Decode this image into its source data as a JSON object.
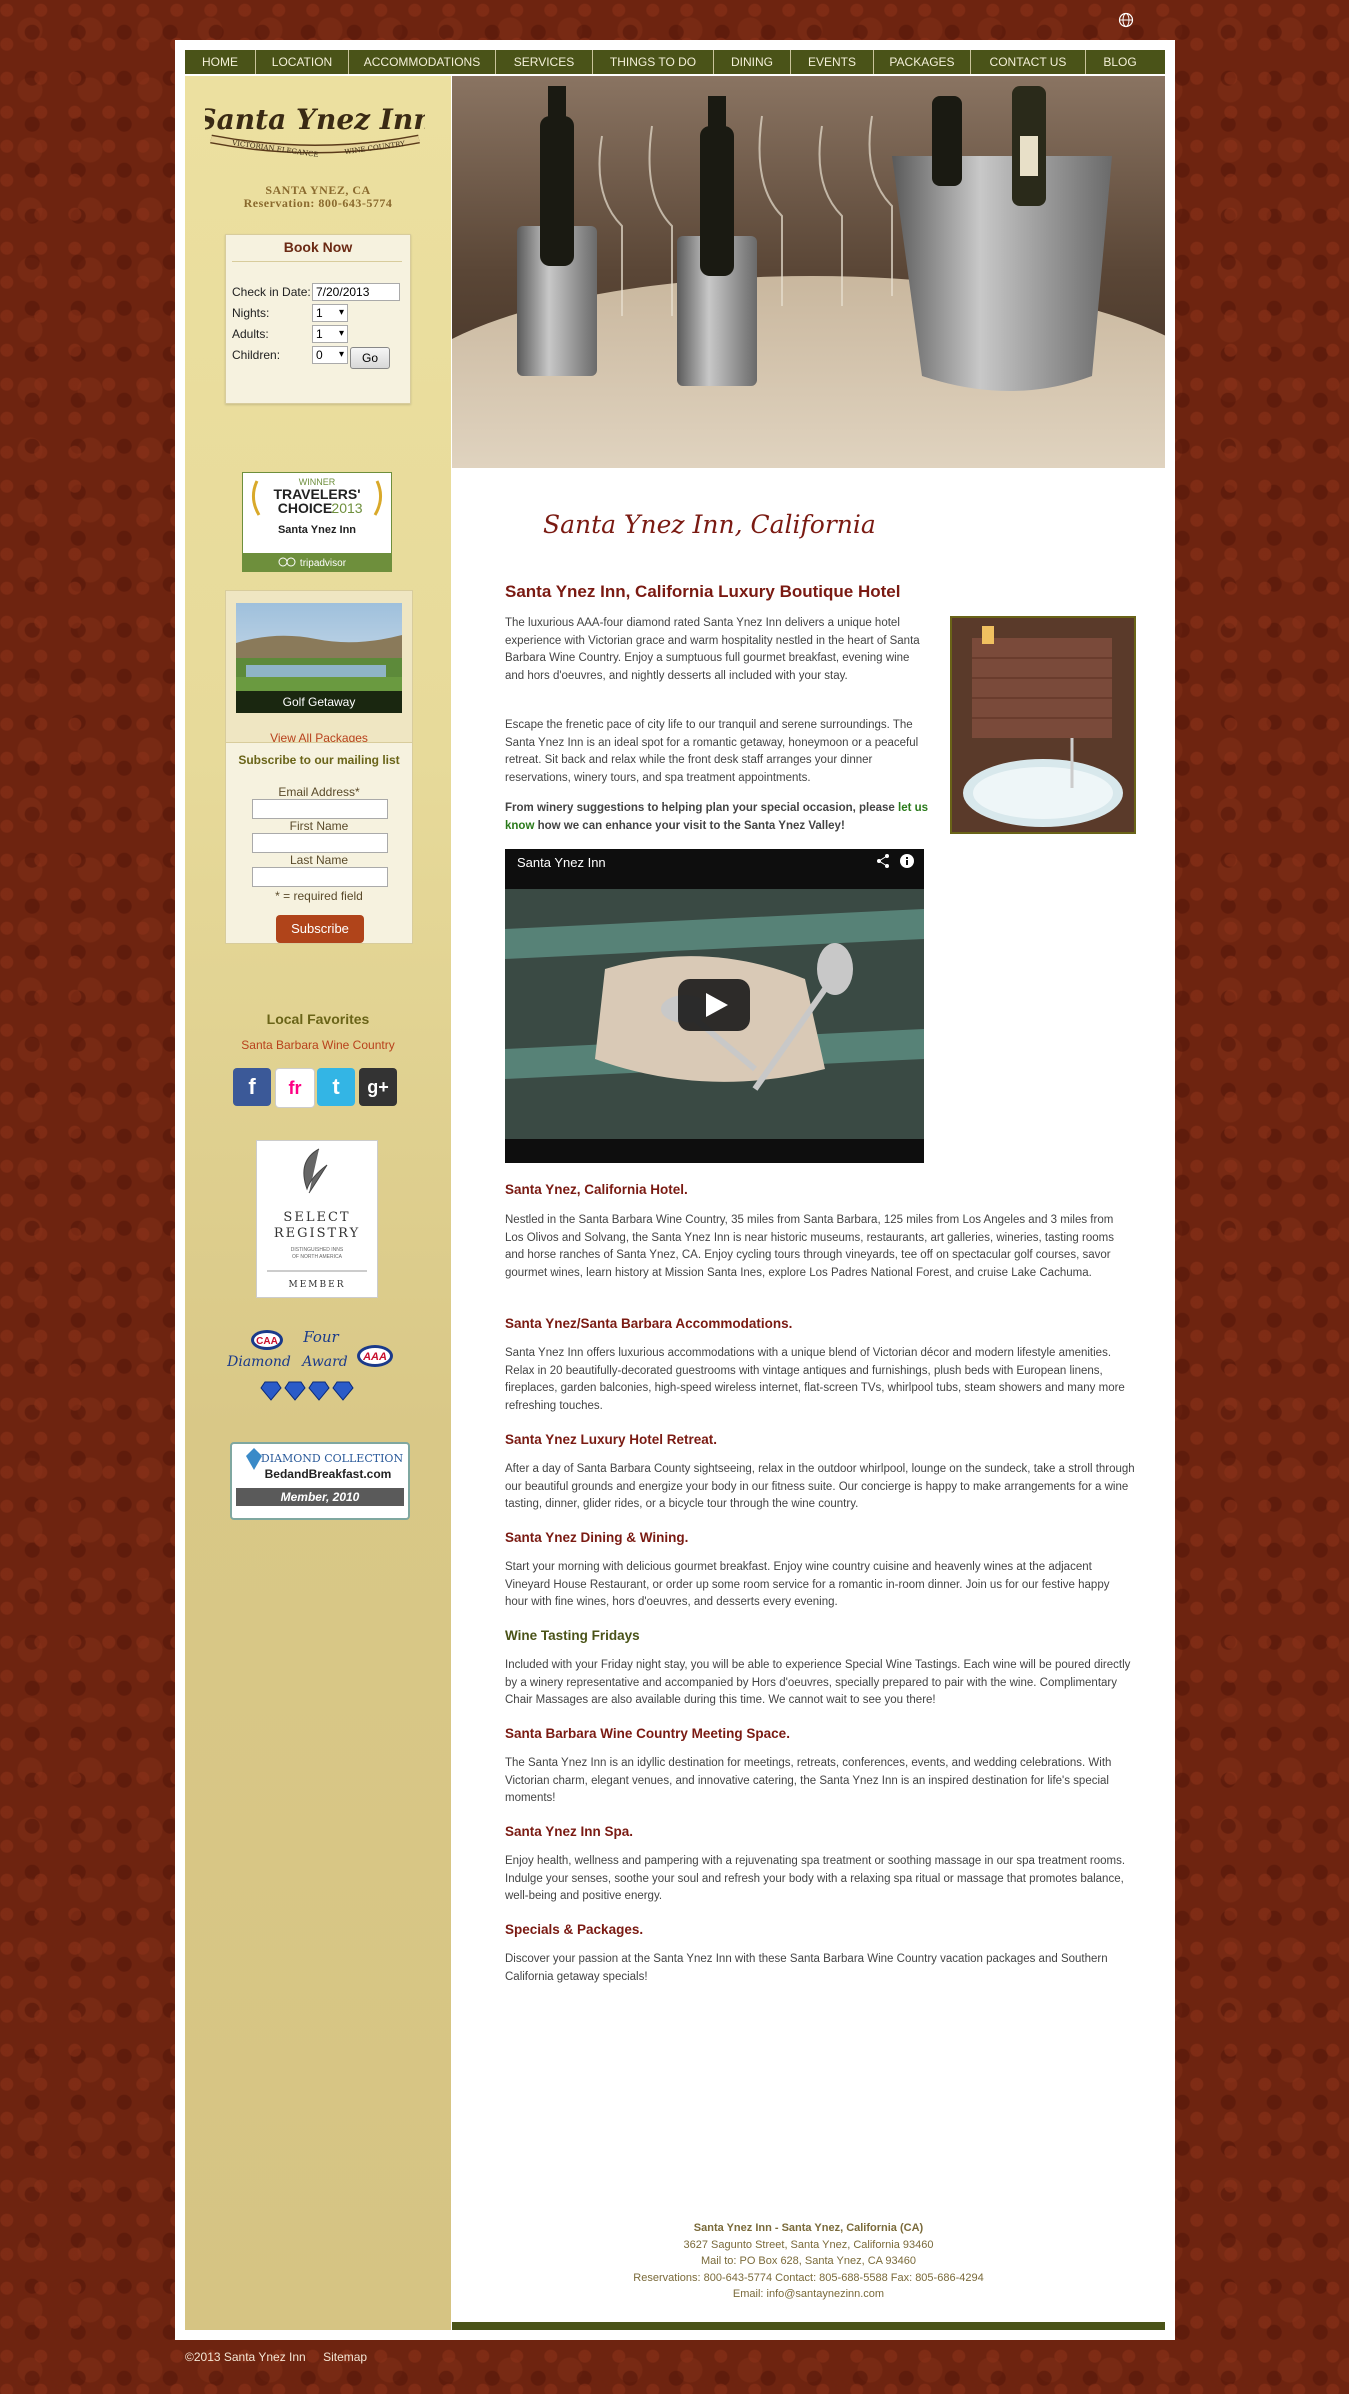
{
  "nav": [
    "HOME",
    "LOCATION",
    "ACCOMMODATIONS",
    "SERVICES",
    "THINGS TO DO",
    "DINING",
    "EVENTS",
    "PACKAGES",
    "CONTACT US",
    "BLOG"
  ],
  "sidebar": {
    "logo": {
      "line1": "Santa Ynez Inn",
      "line2": "VICTORIAN ELEGANCE",
      "line3": "WINE COUNTRY"
    },
    "location": "SANTA YNEZ, CA",
    "reservation": "Reservation: 800-643-5774",
    "booking": {
      "title": "Book Now",
      "checkin_label": "Check in Date:",
      "checkin_value": "7/20/2013",
      "nights_label": "Nights:",
      "nights_value": "1",
      "adults_label": "Adults:",
      "adults_value": "1",
      "children_label": "Children:",
      "children_value": "0",
      "go_label": "Go"
    },
    "tripadvisor": {
      "winner": "WINNER",
      "title": "TRAVELERS'",
      "title2": "CHOICE",
      "year": "2013",
      "name": "Santa Ynez Inn",
      "brand": "tripadvisor"
    },
    "package": {
      "caption": "Golf Getaway",
      "view_all": "View All Packages"
    },
    "mailing": {
      "title": "Subscribe to our mailing list",
      "email_label": "Email Address*",
      "first_label": "First Name",
      "last_label": "Last Name",
      "required_note": "* = required field",
      "subscribe_label": "Subscribe"
    },
    "favorites": {
      "title": "Local Favorites",
      "link": "Santa Barbara Wine Country"
    },
    "social": [
      "f",
      "fr",
      "t",
      "g+"
    ],
    "select_registry": {
      "l1": "SELECT",
      "l2": "REGISTRY",
      "l3": "DISTINGUISHED INNS",
      "l4": "OF NORTH AMERICA",
      "l5": "MEMBER"
    },
    "aaa": {
      "l1": "Four",
      "l2": "Diamond",
      "l3": "Award",
      "caa": "CAA",
      "aaa": "AAA"
    },
    "diamond_collection": {
      "l1": "DIAMOND COLLECTION",
      "l2": "BedandBreakfast.com",
      "l3": "Member, 2010"
    }
  },
  "main": {
    "script_title": "Santa Ynez Inn, California",
    "heading": "Santa Ynez Inn, California Luxury Boutique Hotel",
    "intro1": "The luxurious AAA-four diamond rated Santa Ynez Inn delivers a unique hotel experience with Victorian grace and warm hospitality nestled in the heart of Santa Barbara Wine Country.  Enjoy a sumptuous full gourmet breakfast, evening wine and hors d'oeuvres, and nightly desserts all included with your stay.",
    "intro2": "Escape the frenetic pace of city life to our tranquil and serene surroundings.  The Santa Ynez Inn is an ideal spot for a romantic getaway, honeymoon or a peaceful retreat.  Sit back and relax while the front desk staff arranges your dinner reservations, winery tours, and spa treatment appointments.",
    "intro3_a": "From winery suggestions to helping plan your special occasion, please ",
    "intro3_link": "let us know",
    "intro3_b": " how we can enhance your visit to the Santa Ynez Valley!",
    "video_title": "Santa Ynez Inn",
    "sections": [
      {
        "title": "Santa Ynez, California Hotel.",
        "body": "Nestled in the Santa Barbara Wine Country, 35 miles from Santa Barbara, 125 miles from Los Angeles and 3 miles from Los Olivos and Solvang, the Santa Ynez Inn is near historic museums, restaurants, art galleries, wineries, tasting rooms and horse ranches of Santa Ynez, CA. Enjoy cycling tours through vineyards, tee off on spectacular golf courses, savor gourmet wines, learn history at Mission Santa Ines, explore Los Padres National Forest, and cruise Lake Cachuma."
      },
      {
        "title": "Santa Ynez/Santa Barbara Accommodations.",
        "body": "Santa Ynez Inn offers luxurious accommodations with a unique blend of Victorian décor and modern lifestyle amenities. Relax in 20 beautifully-decorated guestrooms with vintage antiques and furnishings, plush beds with European linens, fireplaces, garden balconies, high-speed wireless internet, flat-screen TVs, whirlpool tubs, steam showers and many more refreshing touches."
      },
      {
        "title": "Santa Ynez Luxury Hotel Retreat.",
        "body": "After a day of Santa Barbara County sightseeing, relax in the outdoor whirlpool, lounge on the sundeck, take a stroll through our beautiful grounds and energize your body in our fitness suite. Our concierge is happy to make arrangements for a wine tasting, dinner, glider rides, or a bicycle tour through the wine country."
      },
      {
        "title": "Santa Ynez Dining & Wining.",
        "body": "Start your morning with delicious gourmet breakfast. Enjoy wine country cuisine and heavenly wines at the adjacent Vineyard House Restaurant, or order up some room service for a romantic in-room dinner. Join us for our festive happy hour with fine wines, hors d'oeuvres, and desserts every evening."
      },
      {
        "title": "Wine Tasting Fridays",
        "body": "Included with your Friday night stay, you will be able to experience Special Wine Tastings. Each wine will be poured directly by a winery representative and accompanied by Hors d'oeuvres, specially prepared to pair with the wine. Complimentary Chair Massages are also available during this time.  We cannot wait to see you there!"
      },
      {
        "title": "Santa Barbara Wine Country Meeting Space.",
        "body": "The Santa Ynez Inn is an idyllic destination for meetings, retreats, conferences, events, and wedding celebrations. With Victorian charm, elegant venues, and innovative catering, the Santa Ynez Inn is an inspired destination for life's special moments!"
      },
      {
        "title": "Santa Ynez Inn Spa.",
        "body": "Enjoy health, wellness and pampering with a rejuvenating spa treatment or soothing massage in our spa treatment rooms. Indulge your senses, soothe your soul and refresh your body with a relaxing spa ritual or massage that promotes balance, well-being and positive energy."
      },
      {
        "title": "Specials & Packages.",
        "body": "Discover your passion at the Santa Ynez Inn with these Santa Barbara Wine Country vacation packages and Southern California getaway specials!"
      }
    ]
  },
  "footer": {
    "name": "Santa Ynez Inn - Santa Ynez, California (CA)",
    "address": "3627 Sagunto Street, Santa Ynez, California 93460",
    "mail": "Mail to: PO Box 628, Santa Ynez, CA 93460",
    "phones": "Reservations: 800-643-5774 Contact: 805-688-5588 Fax: 805-686-4294",
    "email": "Email: info@santaynezinn.com"
  },
  "bottom": {
    "copyright": "©2013 Santa Ynez Inn",
    "sitemap": "Sitemap"
  },
  "colors": {
    "nav": "#4a5318",
    "heading": "#7a1a12",
    "background": "#6e2410",
    "accent_link": "#b8411c"
  }
}
